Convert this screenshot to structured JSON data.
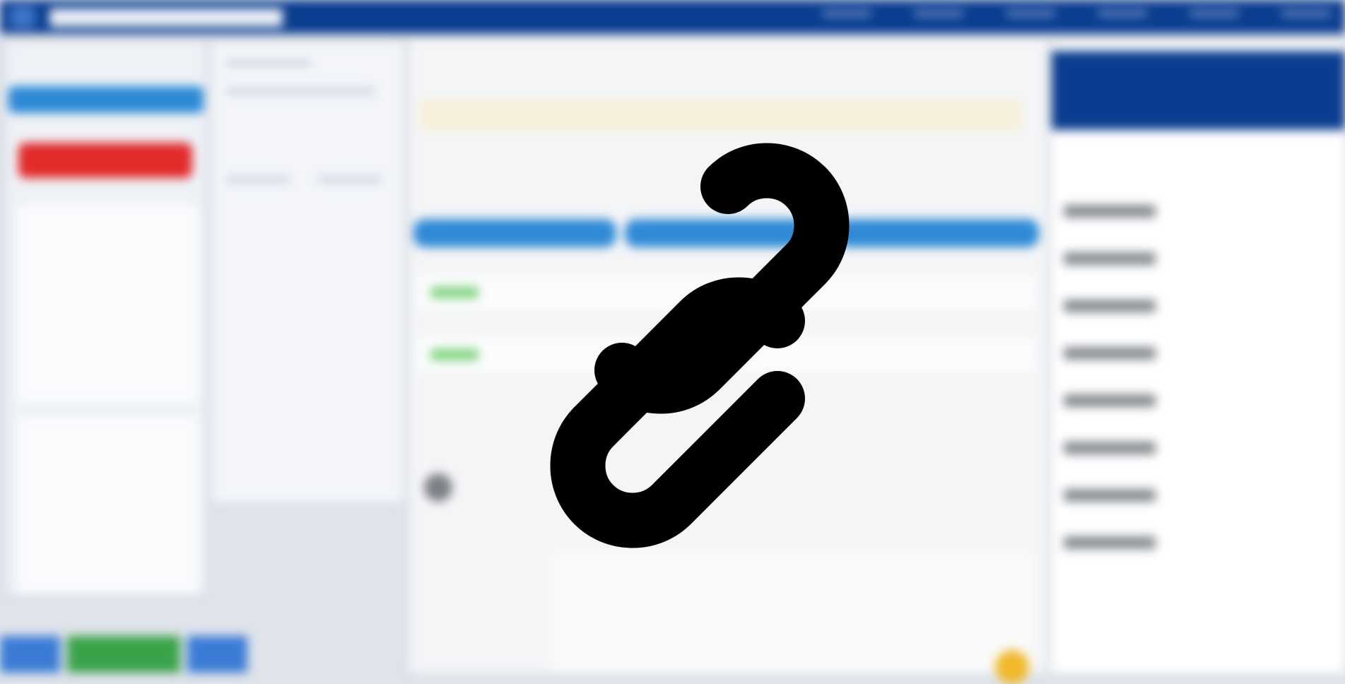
{
  "image": {
    "note": "",
    "overlay_icon": "link-icon",
    "overlay_color": "#000000"
  },
  "colors": {
    "topbar": "#0a3d8f",
    "accent_blue": "#2b8ad6",
    "danger_red": "#e22b2b",
    "success_green": "#7ed37e",
    "warning_yellow": "#f0b92a"
  }
}
